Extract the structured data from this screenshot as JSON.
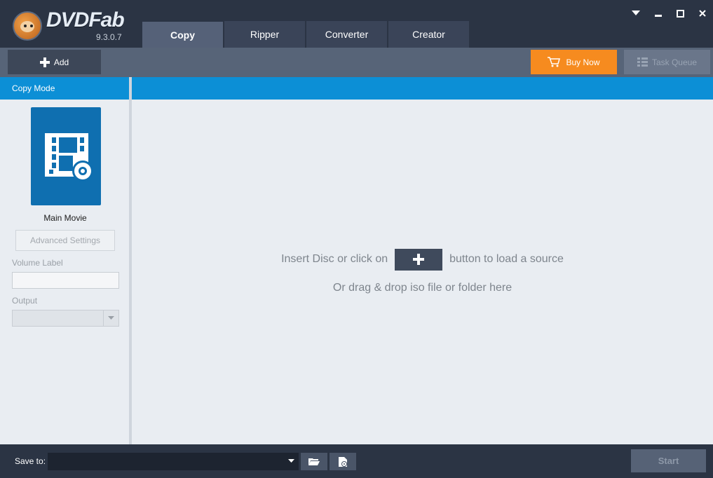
{
  "app": {
    "name": "DVDFab",
    "version": "9.3.0.7"
  },
  "tabs": [
    {
      "label": "Copy",
      "active": true
    },
    {
      "label": "Ripper",
      "active": false
    },
    {
      "label": "Converter",
      "active": false
    },
    {
      "label": "Creator",
      "active": false
    }
  ],
  "window_controls": [
    "dropdown-icon",
    "minimize-icon",
    "maximize-icon",
    "close-icon"
  ],
  "toolbar": {
    "add_label": "Add",
    "buy_label": "Buy Now",
    "queue_label": "Task Queue"
  },
  "left_panel": {
    "header": "Copy Mode",
    "mode_label": "Main Movie",
    "advanced_label": "Advanced Settings",
    "volume_label": "Volume Label",
    "volume_value": "",
    "output_label": "Output",
    "output_value": ""
  },
  "main": {
    "hint_before": "Insert Disc or click on",
    "hint_after": "button to load a source",
    "hint_drag": "Or drag & drop iso file or folder here"
  },
  "bottom": {
    "save_label": "Save to:",
    "save_path": "",
    "start_label": "Start"
  },
  "colors": {
    "accent_blue": "#0c8fd6",
    "buy_orange": "#f68b1f",
    "dark_bg": "#2b3444"
  }
}
